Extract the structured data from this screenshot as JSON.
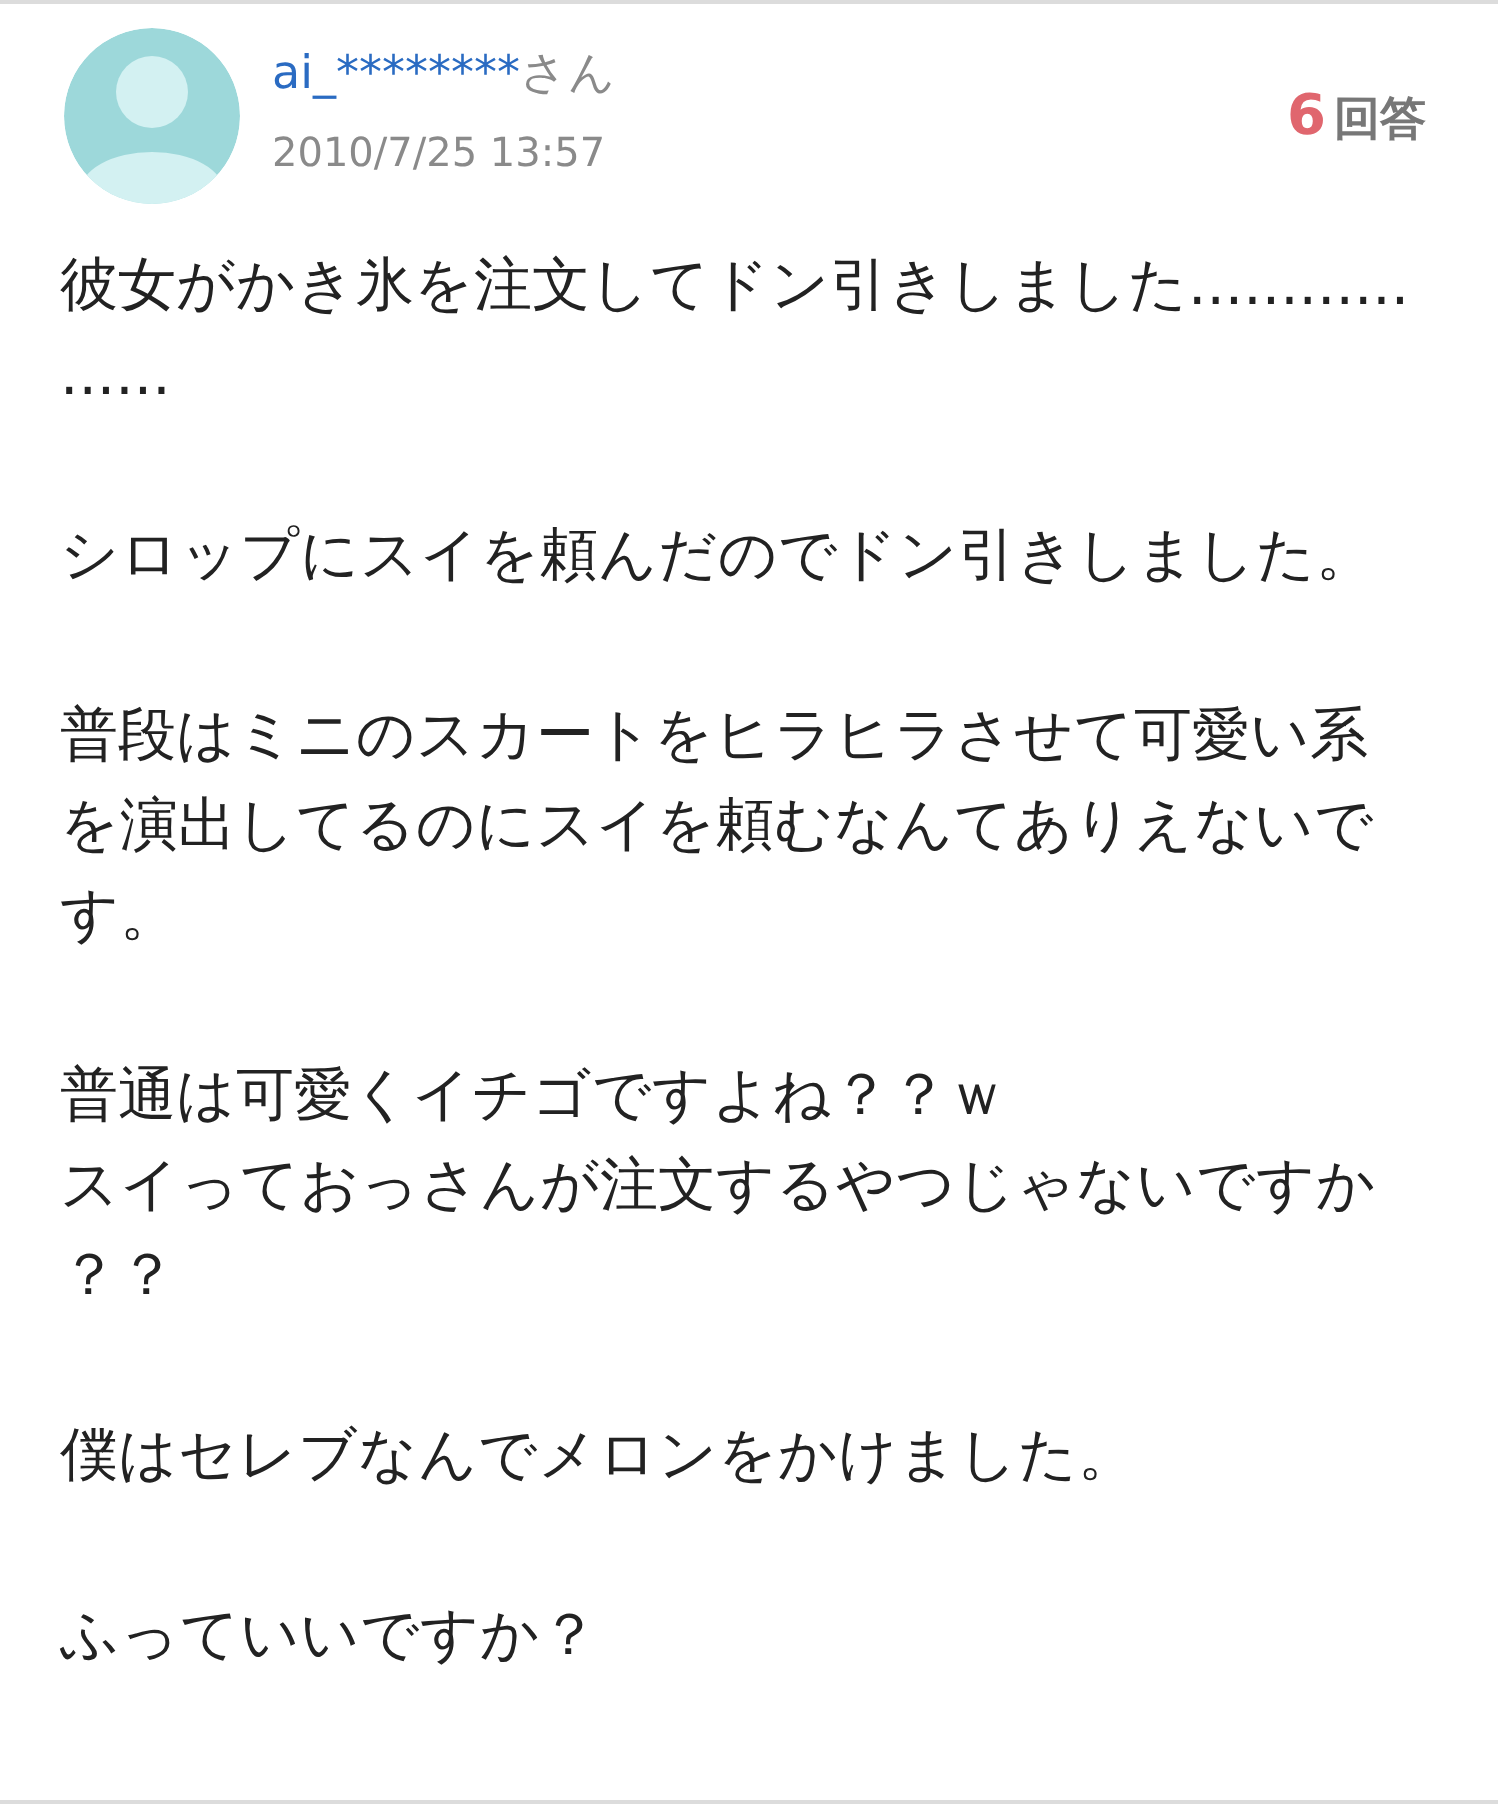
{
  "question": {
    "user": {
      "name": "ai_********",
      "suffix": "さん"
    },
    "date": "2010/7/25 13:57",
    "answers": {
      "count": "6",
      "label": "回答"
    },
    "paragraphs": [
      "彼女がかき氷を注文してドン引きしました..................",
      "シロップにスイを頼んだのでドン引きしました。",
      "普段はミニのスカートをヒラヒラさせて可愛い系を演出してるのにスイを頼むなんてありえないです。",
      [
        "普通は可愛くイチゴですよね？？ｗ",
        "スイっておっさんが注文するやつじゃないですか？？"
      ],
      "僕はセレブなんでメロンをかけました。",
      "ふっていいですか？"
    ]
  }
}
